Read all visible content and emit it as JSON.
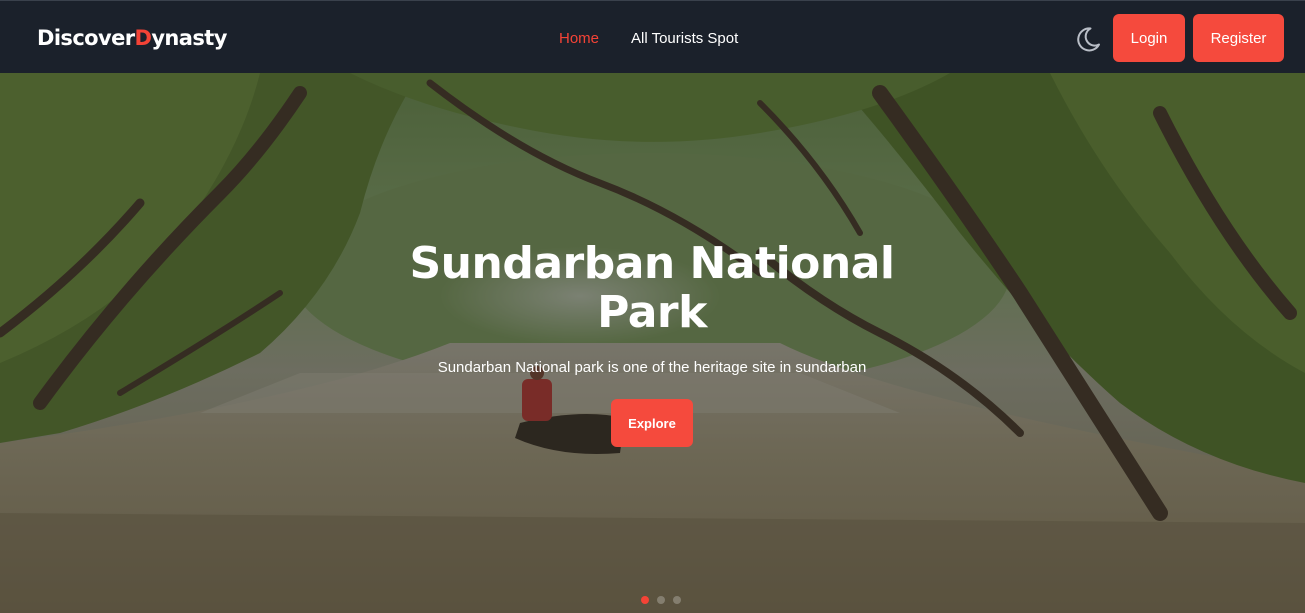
{
  "brand": {
    "name_part1": "Discover",
    "name_accent": "D",
    "name_part2": "ynasty",
    "accent_color": "#f44336"
  },
  "nav": {
    "links": [
      {
        "label": "Home",
        "active": true
      },
      {
        "label": "All Tourists Spot",
        "active": false
      }
    ],
    "theme_toggle_icon": "moon-icon",
    "login_label": "Login",
    "register_label": "Register"
  },
  "hero": {
    "title": "Sundarban National Park",
    "subtitle": "Sundarban National park is one of the heritage site in sundarban",
    "cta_label": "Explore",
    "slides_count": 3,
    "active_slide": 1
  },
  "colors": {
    "navbar_bg": "#1b212b",
    "button_bg": "#f54a3d",
    "text": "#ffffff"
  }
}
